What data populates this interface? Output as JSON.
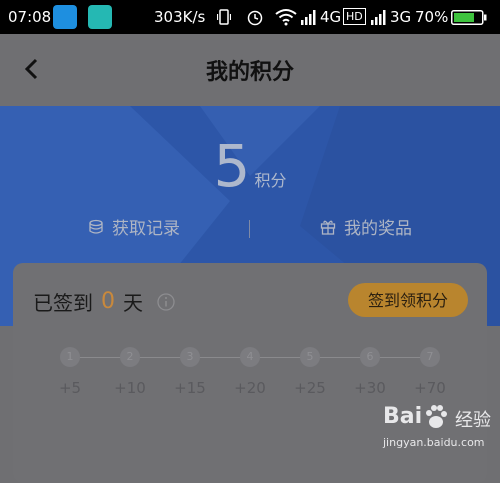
{
  "status_bar": {
    "time": "07:08",
    "speed": "303K/s",
    "network1": "4G",
    "hd": "HD",
    "network2": "3G",
    "battery": "70%"
  },
  "nav": {
    "title": "我的积分"
  },
  "points": {
    "value": "5",
    "unit": "积分"
  },
  "links": {
    "record": "获取记录",
    "prize": "我的奖品"
  },
  "signin": {
    "prefix": "已签到",
    "days": "0",
    "suffix": "天",
    "button": "签到领积分",
    "steps": [
      {
        "day": "1",
        "reward": "+5"
      },
      {
        "day": "2",
        "reward": "+10"
      },
      {
        "day": "3",
        "reward": "+15"
      },
      {
        "day": "4",
        "reward": "+20"
      },
      {
        "day": "5",
        "reward": "+25"
      },
      {
        "day": "6",
        "reward": "+30"
      },
      {
        "day": "7",
        "reward": "+70"
      }
    ]
  },
  "watermark": {
    "logo": "Bai",
    "sub": "经验",
    "url": "jingyan.baidu.com"
  },
  "colors": {
    "hero_blue": "#2d56a8",
    "accent_orange": "#c9893c",
    "button": "#b9852e"
  }
}
